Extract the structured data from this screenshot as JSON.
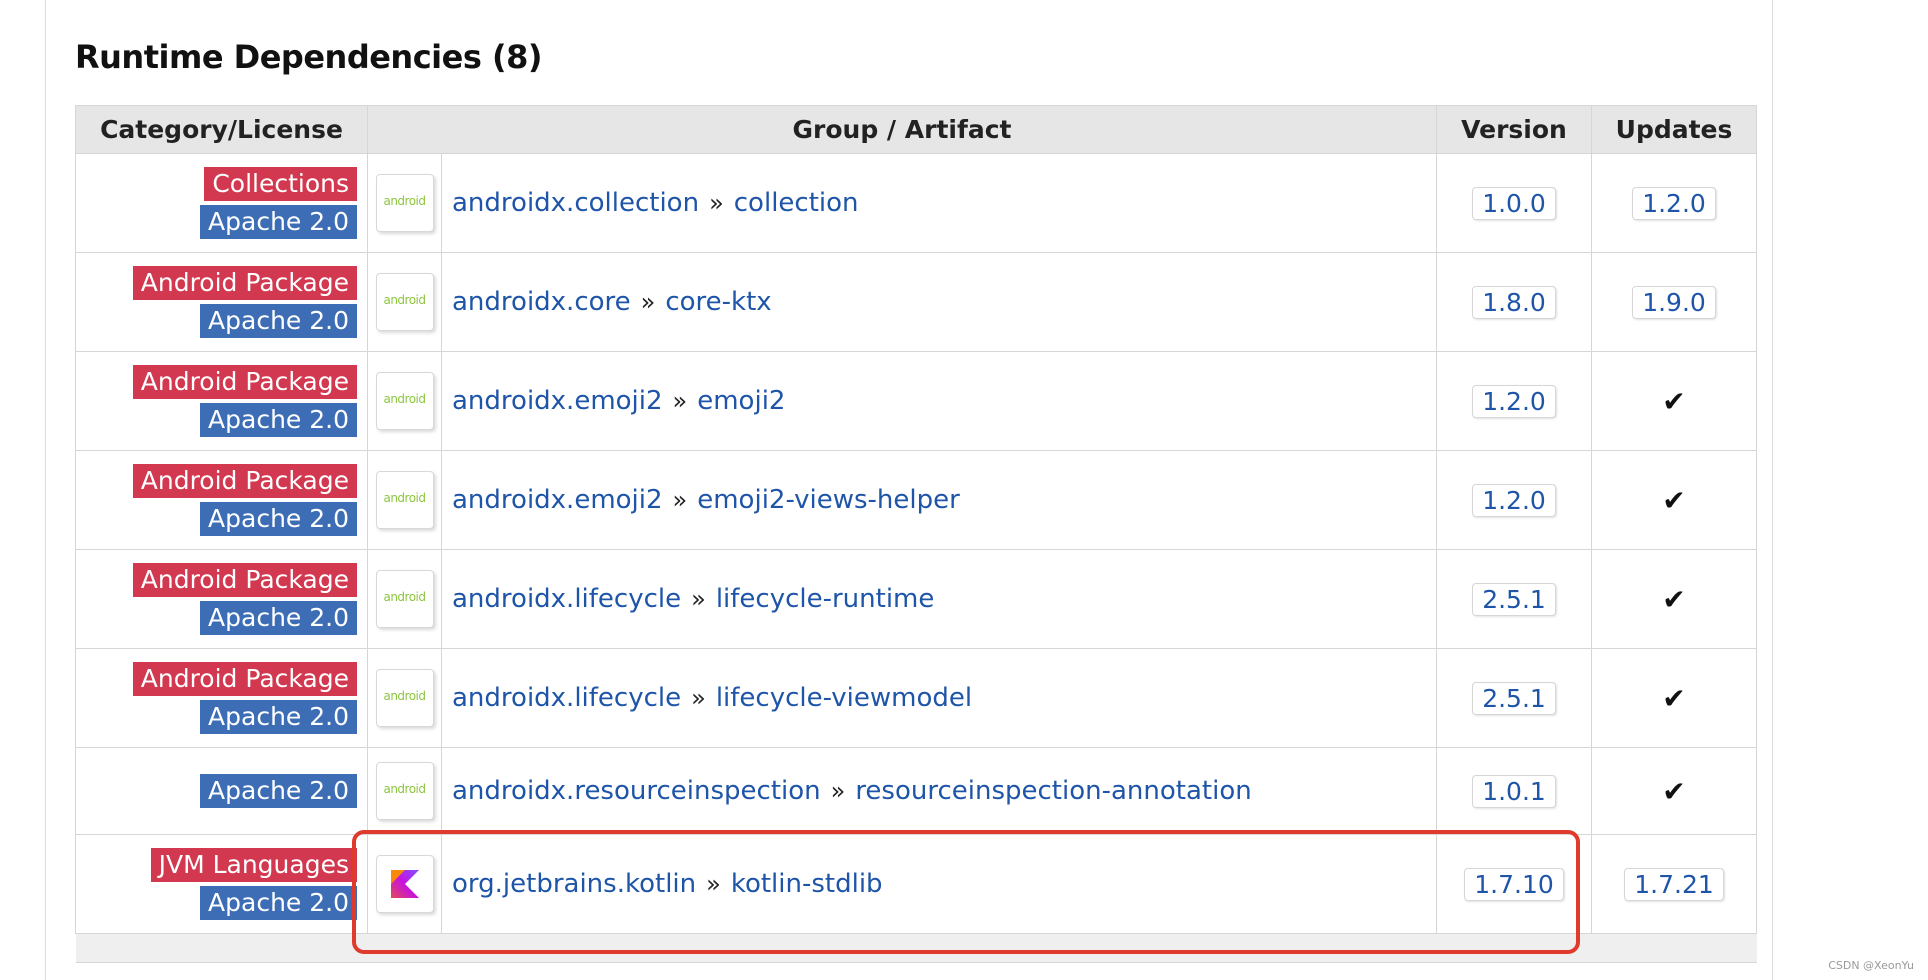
{
  "heading": "Runtime Dependencies (8)",
  "columns": {
    "category": "Category/License",
    "artifact": "Group / Artifact",
    "version": "Version",
    "updates": "Updates"
  },
  "separator": "»",
  "rows": [
    {
      "category": "Collections",
      "license": "Apache 2.0",
      "logo": "android",
      "group": "androidx.collection",
      "artifact": "collection",
      "version": "1.0.0",
      "update": "1.2.0"
    },
    {
      "category": "Android Package",
      "license": "Apache 2.0",
      "logo": "android",
      "group": "androidx.core",
      "artifact": "core-ktx",
      "version": "1.8.0",
      "update": "1.9.0"
    },
    {
      "category": "Android Package",
      "license": "Apache 2.0",
      "logo": "android",
      "group": "androidx.emoji2",
      "artifact": "emoji2",
      "version": "1.2.0",
      "update": "✔"
    },
    {
      "category": "Android Package",
      "license": "Apache 2.0",
      "logo": "android",
      "group": "androidx.emoji2",
      "artifact": "emoji2-views-helper",
      "version": "1.2.0",
      "update": "✔"
    },
    {
      "category": "Android Package",
      "license": "Apache 2.0",
      "logo": "android",
      "group": "androidx.lifecycle",
      "artifact": "lifecycle-runtime",
      "version": "2.5.1",
      "update": "✔"
    },
    {
      "category": "Android Package",
      "license": "Apache 2.0",
      "logo": "android",
      "group": "androidx.lifecycle",
      "artifact": "lifecycle-viewmodel",
      "version": "2.5.1",
      "update": "✔"
    },
    {
      "category": "",
      "license": "Apache 2.0",
      "logo": "android",
      "group": "androidx.resourceinspection",
      "artifact": "resourceinspection-annotation",
      "version": "1.0.1",
      "update": "✔"
    },
    {
      "category": "JVM Languages",
      "license": "Apache 2.0",
      "logo": "kotlin",
      "group": "org.jetbrains.kotlin",
      "artifact": "kotlin-stdlib",
      "version": "1.7.10",
      "update": "1.7.21"
    }
  ],
  "logo_text": {
    "android": "android"
  },
  "colors": {
    "category_badge": "#d2384f",
    "license_badge": "#3d6eb5",
    "link": "#1f55a8",
    "highlight": "#e03a2c"
  },
  "watermark": "CSDN @XeonYu"
}
